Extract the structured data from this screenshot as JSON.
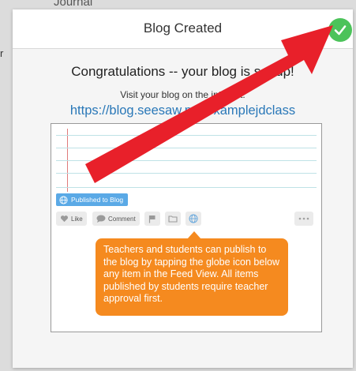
{
  "background": {
    "partial_title": "Journal",
    "partial_letter": "r"
  },
  "modal": {
    "title": "Blog Created",
    "congrats": "Congratulations -- your blog is set up!",
    "visit_text": "Visit your blog on the internet:",
    "blog_url": "https://blog.seesaw.me/examplejdclass"
  },
  "preview": {
    "published_badge": "Published to Blog",
    "like_label": "Like",
    "comment_label": "Comment",
    "tooltip": "Teachers and students can publish to the blog by tapping the globe icon below any item in the Feed View. All items published by students require teacher approval first."
  },
  "colors": {
    "accent_green": "#4cc35a",
    "link_blue": "#2a78b8",
    "tooltip_orange": "#f58a1f",
    "arrow_red": "#e8202a"
  }
}
